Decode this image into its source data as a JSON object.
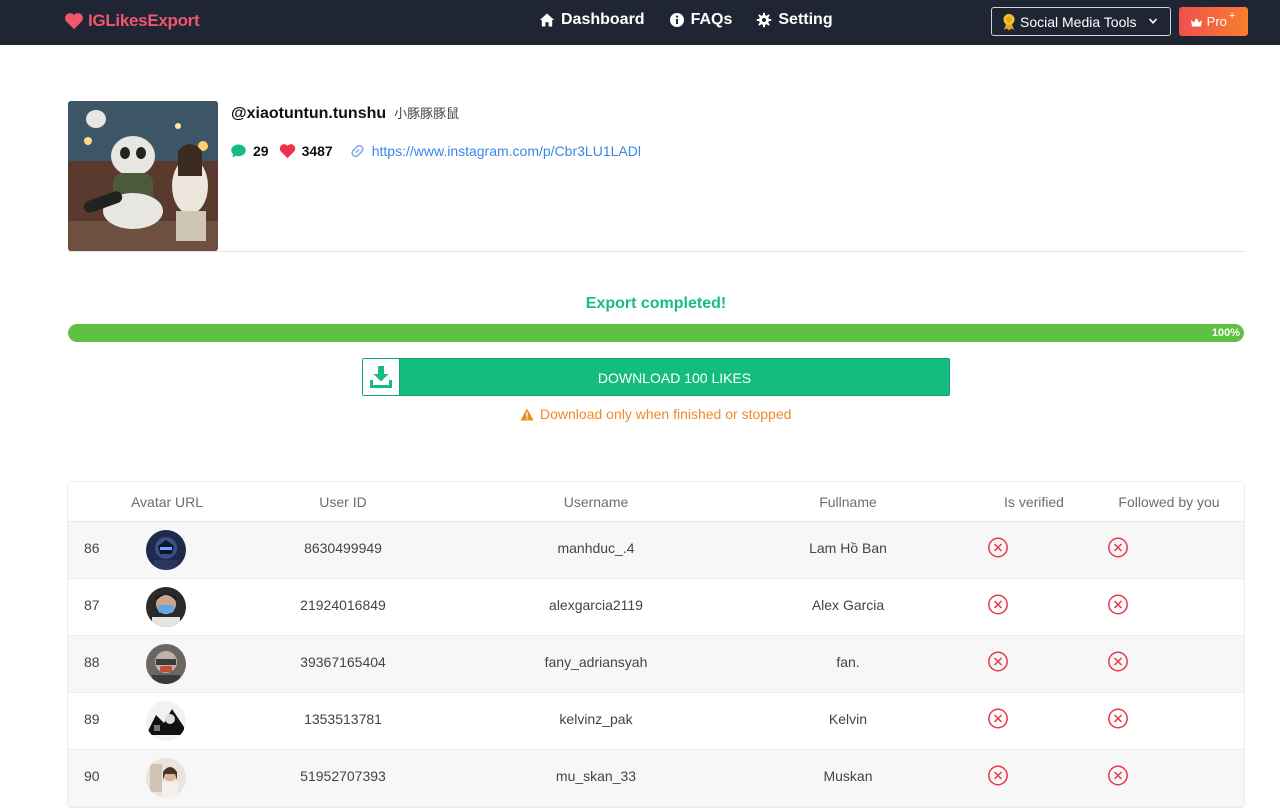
{
  "navbar": {
    "brand": "IGLikesExport",
    "links": [
      {
        "label": "Dashboard",
        "icon": "home-icon"
      },
      {
        "label": "FAQs",
        "icon": "info-icon"
      },
      {
        "label": "Setting",
        "icon": "gear-icon"
      }
    ],
    "tools_label": "Social Media Tools",
    "pro_label": "Pro",
    "pro_sup": "+"
  },
  "post": {
    "username": "@xiaotuntun.tunshu",
    "fullname": "小豚豚豚鼠",
    "comments": "29",
    "likes": "3487",
    "url": "https://www.instagram.com/p/Cbr3LU1LADl"
  },
  "export": {
    "status": "Export completed!",
    "progress_fraction": 1.0,
    "progress_label": "100%",
    "download_label": "DOWNLOAD 100 LIKES",
    "warning": "Download only when finished or stopped"
  },
  "table": {
    "headers": [
      "Avatar URL",
      "User ID",
      "Username",
      "Fullname",
      "Is verified",
      "Followed by you"
    ],
    "rows": [
      {
        "index": "86",
        "user_id": "8630499949",
        "username": "manhduc_.4",
        "fullname": "Lam Hồ Ban",
        "is_verified": false,
        "followed": false
      },
      {
        "index": "87",
        "user_id": "21924016849",
        "username": "alexgarcia2119",
        "fullname": "Alex Garcia",
        "is_verified": false,
        "followed": false
      },
      {
        "index": "88",
        "user_id": "39367165404",
        "username": "fany_adriansyah",
        "fullname": "fan.",
        "is_verified": false,
        "followed": false
      },
      {
        "index": "89",
        "user_id": "1353513781",
        "username": "kelvinz_pak",
        "fullname": "Kelvin",
        "is_verified": false,
        "followed": false
      },
      {
        "index": "90",
        "user_id": "51952707393",
        "username": "mu_skan_33",
        "fullname": "Muskan",
        "is_verified": false,
        "followed": false
      }
    ]
  },
  "colors": {
    "navbar_bg": "#1f2533",
    "brand": "#f0566c",
    "accent_green": "#14bd7e",
    "progress_green": "#5fc142",
    "warning_orange": "#f08a24",
    "link_blue": "#3a86e8",
    "x_red": "#e8394d"
  }
}
